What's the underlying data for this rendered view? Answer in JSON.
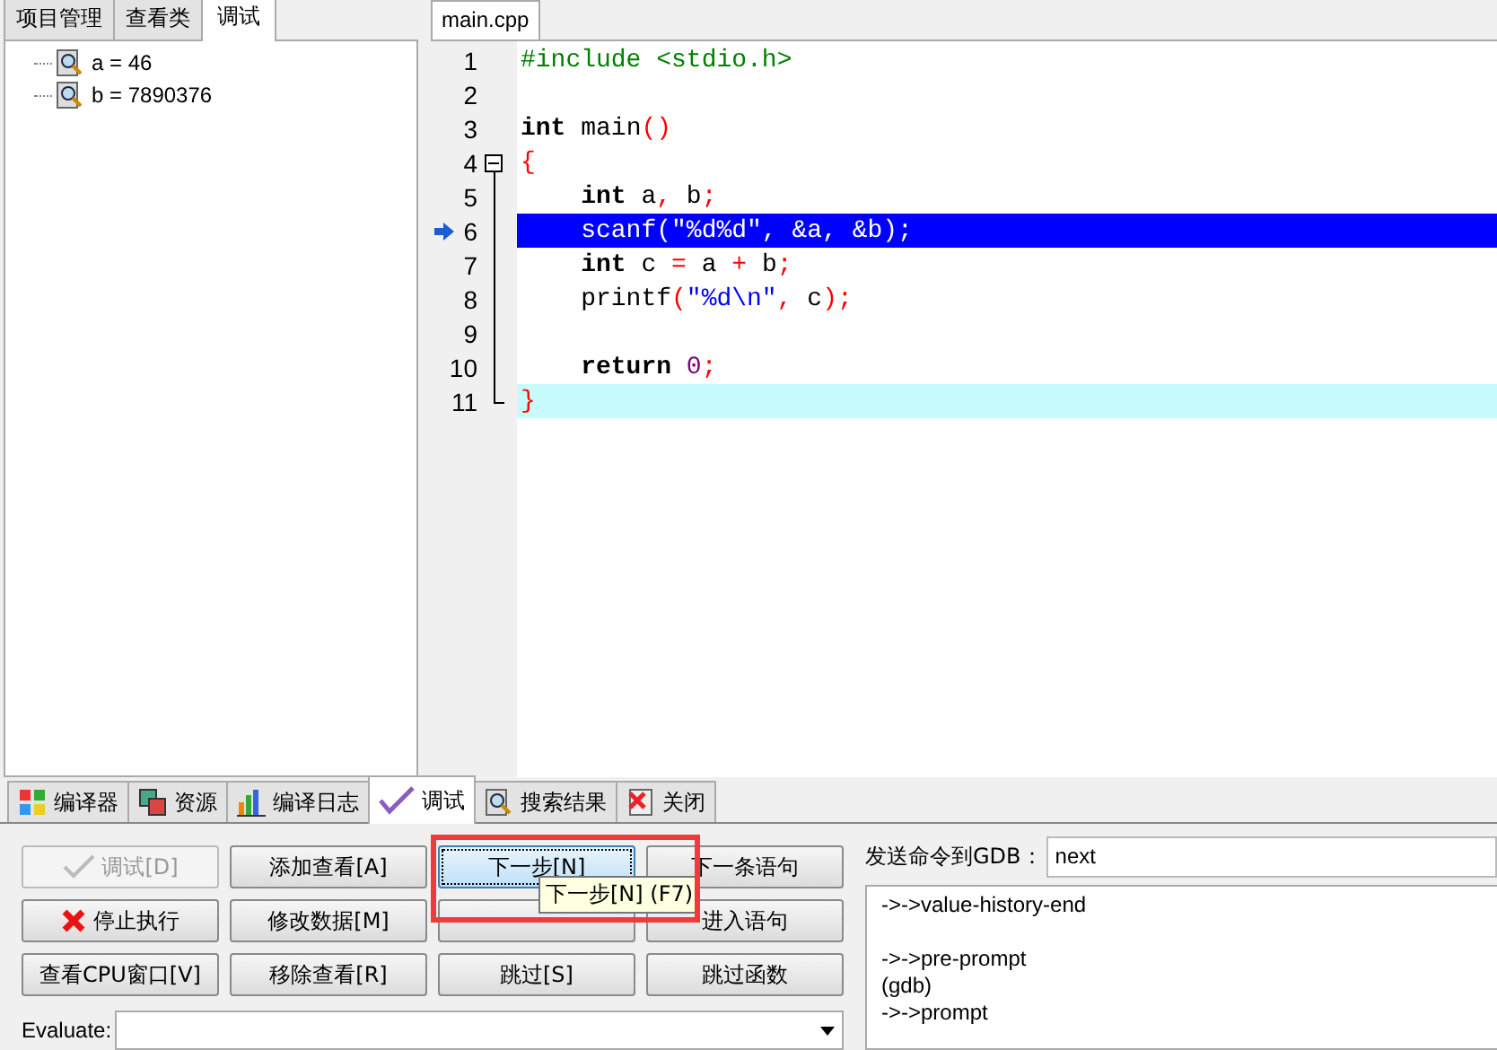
{
  "left_panel": {
    "tabs": [
      {
        "label": "项目管理",
        "selected": false
      },
      {
        "label": "查看类",
        "selected": false
      },
      {
        "label": "调试",
        "selected": true
      }
    ],
    "watches": [
      {
        "label": "a = 46"
      },
      {
        "label": "b = 7890376"
      }
    ]
  },
  "editor": {
    "tab": "main.cpp",
    "lines": [
      {
        "number": "1",
        "executing": false,
        "caret_line": false,
        "tokens": [
          {
            "kind": "preprocessor",
            "text": "#include <stdio.h>"
          }
        ]
      },
      {
        "number": "2",
        "executing": false,
        "caret_line": false
      },
      {
        "number": "3",
        "executing": false,
        "caret_line": false,
        "tokens": [
          {
            "kind": "keyword",
            "text": "int"
          },
          {
            "kind": "ident",
            "text": " main"
          },
          {
            "kind": "punct",
            "text": "()"
          }
        ]
      },
      {
        "number": "4",
        "executing": false,
        "caret_line": false,
        "collapsed": false,
        "tokens": [
          {
            "kind": "punct",
            "text": "{"
          }
        ]
      },
      {
        "number": "5",
        "executing": false,
        "caret_line": false,
        "tokens": [
          {
            "kind": "keyword",
            "text": "    int"
          },
          {
            "kind": "ident",
            "text": " a"
          },
          {
            "kind": "punct",
            "text": ","
          },
          {
            "kind": "ident",
            "text": " b"
          },
          {
            "kind": "punct",
            "text": ";"
          }
        ]
      },
      {
        "number": "6",
        "executing": true,
        "caret_line": false,
        "tokens": [
          {
            "kind": "ident",
            "text": "    scanf(\"%d%d\", &a, &b);"
          }
        ]
      },
      {
        "number": "7",
        "executing": false,
        "caret_line": false,
        "tokens": [
          {
            "kind": "keyword",
            "text": "    int"
          },
          {
            "kind": "ident",
            "text": " c "
          },
          {
            "kind": "punct",
            "text": "="
          },
          {
            "kind": "ident",
            "text": " a "
          },
          {
            "kind": "punct",
            "text": "+"
          },
          {
            "kind": "ident",
            "text": " b"
          },
          {
            "kind": "punct",
            "text": ";"
          }
        ]
      },
      {
        "number": "8",
        "executing": false,
        "caret_line": false,
        "tokens": [
          {
            "kind": "ident",
            "text": "    printf"
          },
          {
            "kind": "punct",
            "text": "("
          },
          {
            "kind": "string",
            "text": "\"%d\\n\""
          },
          {
            "kind": "punct",
            "text": ","
          },
          {
            "kind": "ident",
            "text": " c"
          },
          {
            "kind": "punct",
            "text": ");"
          }
        ]
      },
      {
        "number": "9",
        "executing": false,
        "caret_line": false
      },
      {
        "number": "10",
        "executing": false,
        "caret_line": false,
        "tokens": [
          {
            "kind": "keyword",
            "text": "    return"
          },
          {
            "kind": "number",
            "text": " 0"
          },
          {
            "kind": "punct",
            "text": ";"
          }
        ]
      },
      {
        "number": "11",
        "executing": false,
        "caret_line": true,
        "tokens": [
          {
            "kind": "punct",
            "text": "}"
          }
        ]
      }
    ]
  },
  "bottom_tabs": [
    {
      "label": "编译器",
      "selected": false
    },
    {
      "label": "资源",
      "selected": false
    },
    {
      "label": "编译日志",
      "selected": false
    },
    {
      "label": "调试",
      "selected": true
    },
    {
      "label": "搜索结果",
      "selected": false
    },
    {
      "label": "关闭",
      "selected": false
    }
  ],
  "buttons": [
    {
      "label": "调试[D]",
      "disabled": true,
      "focused": false
    },
    {
      "label": "添加查看[A]",
      "disabled": false,
      "focused": false
    },
    {
      "label": "下一步[N]",
      "disabled": false,
      "focused": true
    },
    {
      "label": "下一条语句",
      "disabled": false,
      "focused": false
    },
    {
      "label": "停止执行",
      "disabled": false,
      "focused": false
    },
    {
      "label": "修改数据[M]",
      "disabled": false,
      "focused": false
    },
    {
      "disabled": false,
      "focused": false
    },
    {
      "label": "进入语句",
      "disabled": false,
      "focused": false
    },
    {
      "label": "查看CPU窗口[V]",
      "disabled": false,
      "focused": false
    },
    {
      "label": "移除查看[R]",
      "disabled": false,
      "focused": false
    },
    {
      "label": "跳过[S]",
      "disabled": false,
      "focused": false
    },
    {
      "label": "跳过函数",
      "disabled": false,
      "focused": false
    }
  ],
  "tooltip": "下一步[N] (F7)",
  "gdb": {
    "label": "发送命令到GDB：",
    "value": "next",
    "output": [
      [
        "->->value-history-end"
      ],
      [
        "->->pre-prompt",
        "(gdb)",
        "->->prompt"
      ]
    ]
  },
  "evaluate": {
    "label": "Evaluate:"
  }
}
